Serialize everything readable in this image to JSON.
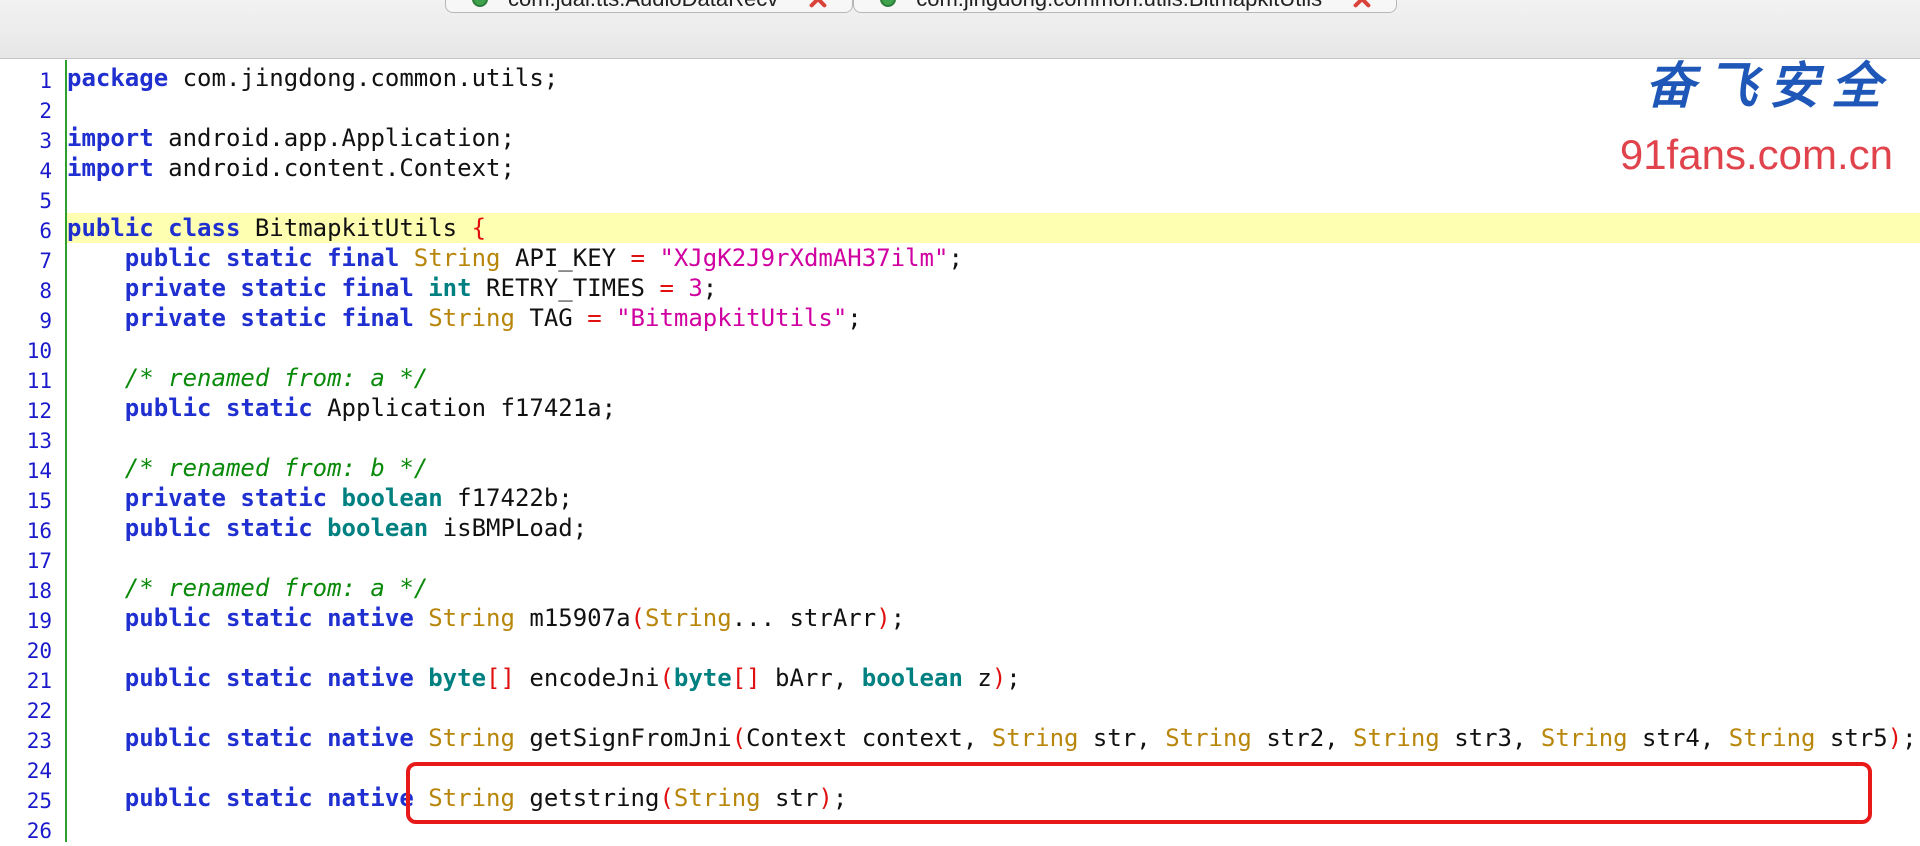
{
  "tabs": [
    {
      "label": "com.jdai.tts.AudioDataRecv"
    },
    {
      "label": "com.jingdong.common.utils.BitmapkitUtils"
    }
  ],
  "watermark": {
    "chinese": "奋飞安全",
    "url": "91fans.com.cn"
  },
  "colors": {
    "keyword": "#1f2fd0",
    "primitive": "#008080",
    "class": "#b8860b",
    "string": "#d000a0",
    "comment": "#0a8a0a",
    "paren": "#e01010",
    "highlight": "#ffffb2",
    "redbox": "#e81919"
  },
  "lines": [
    {
      "n": "1",
      "code": [
        [
          "kw",
          "package"
        ],
        [
          "",
          "com.jingdong.common.utils;"
        ]
      ]
    },
    {
      "n": "2",
      "code": []
    },
    {
      "n": "3",
      "code": [
        [
          "kw",
          "import"
        ],
        [
          "",
          "android.app.Application;"
        ]
      ]
    },
    {
      "n": "4",
      "code": [
        [
          "kw",
          "import"
        ],
        [
          "",
          "android.content.Context;"
        ]
      ]
    },
    {
      "n": "5",
      "code": []
    },
    {
      "n": "6",
      "code": [
        [
          "kw",
          "public class"
        ],
        [
          "",
          "BitmapkitUtils "
        ],
        [
          "pn",
          "{"
        ]
      ],
      "hl": true
    },
    {
      "n": "7",
      "code": [
        [
          "",
          "    "
        ],
        [
          "kw",
          "public static final"
        ],
        [
          "",
          " "
        ],
        [
          "cl",
          "String"
        ],
        [
          "",
          " API_KEY "
        ],
        [
          "pn",
          "="
        ],
        [
          "",
          " "
        ],
        [
          "st",
          "\"XJgK2J9rXdmAH37ilm\""
        ],
        [
          "",
          ";"
        ]
      ]
    },
    {
      "n": "8",
      "code": [
        [
          "",
          "    "
        ],
        [
          "kw",
          "private static final"
        ],
        [
          "",
          " "
        ],
        [
          "ty",
          "int"
        ],
        [
          "",
          " RETRY_TIMES "
        ],
        [
          "pn",
          "="
        ],
        [
          "",
          " "
        ],
        [
          "st",
          "3"
        ],
        [
          "",
          ";"
        ]
      ]
    },
    {
      "n": "9",
      "code": [
        [
          "",
          "    "
        ],
        [
          "kw",
          "private static final"
        ],
        [
          "",
          " "
        ],
        [
          "cl",
          "String"
        ],
        [
          "",
          " TAG "
        ],
        [
          "pn",
          "="
        ],
        [
          "",
          " "
        ],
        [
          "st",
          "\"BitmapkitUtils\""
        ],
        [
          "",
          ";"
        ]
      ]
    },
    {
      "n": "10",
      "code": []
    },
    {
      "n": "11",
      "code": [
        [
          "",
          "    "
        ],
        [
          "cm",
          "/* renamed from: a */"
        ]
      ]
    },
    {
      "n": "12",
      "code": [
        [
          "",
          "    "
        ],
        [
          "kw",
          "public static"
        ],
        [
          "",
          " Application f17421a;"
        ]
      ]
    },
    {
      "n": "13",
      "code": []
    },
    {
      "n": "14",
      "code": [
        [
          "",
          "    "
        ],
        [
          "cm",
          "/* renamed from: b */"
        ]
      ]
    },
    {
      "n": "15",
      "code": [
        [
          "",
          "    "
        ],
        [
          "kw",
          "private static"
        ],
        [
          "",
          " "
        ],
        [
          "ty",
          "boolean"
        ],
        [
          "",
          " f17422b;"
        ]
      ]
    },
    {
      "n": "16",
      "code": [
        [
          "",
          "    "
        ],
        [
          "kw",
          "public static"
        ],
        [
          "",
          " "
        ],
        [
          "ty",
          "boolean"
        ],
        [
          "",
          " isBMPLoad;"
        ]
      ]
    },
    {
      "n": "17",
      "code": []
    },
    {
      "n": "18",
      "code": [
        [
          "",
          "    "
        ],
        [
          "cm",
          "/* renamed from: a */"
        ]
      ]
    },
    {
      "n": "19",
      "code": [
        [
          "",
          "    "
        ],
        [
          "kw",
          "public static native"
        ],
        [
          "",
          " "
        ],
        [
          "cl",
          "String"
        ],
        [
          "",
          " m15907a"
        ],
        [
          "pn",
          "("
        ],
        [
          "cl",
          "String"
        ],
        [
          "",
          "... strArr"
        ],
        [
          "pn",
          ")"
        ],
        [
          "",
          ";"
        ]
      ]
    },
    {
      "n": "20",
      "code": []
    },
    {
      "n": "21",
      "code": [
        [
          "",
          "    "
        ],
        [
          "kw",
          "public static native"
        ],
        [
          "",
          " "
        ],
        [
          "ty",
          "byte"
        ],
        [
          "pn",
          "[]"
        ],
        [
          "",
          " encodeJni"
        ],
        [
          "pn",
          "("
        ],
        [
          "ty",
          "byte"
        ],
        [
          "pn",
          "[]"
        ],
        [
          "",
          " bArr, "
        ],
        [
          "ty",
          "boolean"
        ],
        [
          "",
          " z"
        ],
        [
          "pn",
          ")"
        ],
        [
          "",
          ";"
        ]
      ]
    },
    {
      "n": "22",
      "code": []
    },
    {
      "n": "23",
      "code": [
        [
          "",
          "    "
        ],
        [
          "kw",
          "public static native"
        ],
        [
          "",
          " "
        ],
        [
          "cl",
          "String"
        ],
        [
          "",
          " getSignFromJni"
        ],
        [
          "pn",
          "("
        ],
        [
          "",
          "Context context, "
        ],
        [
          "cl",
          "String"
        ],
        [
          "",
          " str, "
        ],
        [
          "cl",
          "String"
        ],
        [
          "",
          " str2, "
        ],
        [
          "cl",
          "String"
        ],
        [
          "",
          " str3, "
        ],
        [
          "cl",
          "String"
        ],
        [
          "",
          " str4, "
        ],
        [
          "cl",
          "String"
        ],
        [
          "",
          " str5"
        ],
        [
          "pn",
          ")"
        ],
        [
          "",
          ";"
        ]
      ]
    },
    {
      "n": "24",
      "code": []
    },
    {
      "n": "25",
      "code": [
        [
          "",
          "    "
        ],
        [
          "kw",
          "public static native"
        ],
        [
          "",
          " "
        ],
        [
          "cl",
          "String"
        ],
        [
          "",
          " getstring"
        ],
        [
          "pn",
          "("
        ],
        [
          "cl",
          "String"
        ],
        [
          "",
          " str"
        ],
        [
          "pn",
          ")"
        ],
        [
          "",
          ";"
        ]
      ]
    },
    {
      "n": "26",
      "code": []
    }
  ]
}
